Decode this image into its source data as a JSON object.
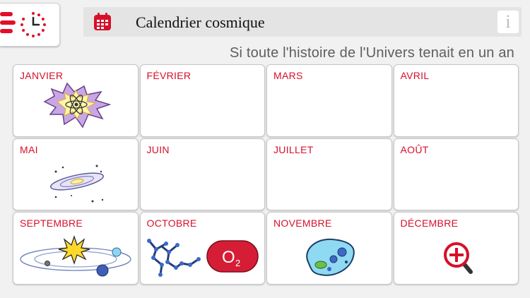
{
  "header": {
    "title": "Calendrier cosmique",
    "info_label": "i"
  },
  "subtitle": "Si toute l'histoire de l'Univers tenait en un an",
  "months": [
    {
      "label": "JANVIER",
      "icon": "big-bang-atom-icon"
    },
    {
      "label": "FÉVRIER",
      "icon": null
    },
    {
      "label": "MARS",
      "icon": null
    },
    {
      "label": "AVRIL",
      "icon": null
    },
    {
      "label": "MAI",
      "icon": "galaxy-icon"
    },
    {
      "label": "JUIN",
      "icon": null
    },
    {
      "label": "JUILLET",
      "icon": null
    },
    {
      "label": "AOÛT",
      "icon": null
    },
    {
      "label": "SEPTEMBRE",
      "icon": "solar-system-icon"
    },
    {
      "label": "OCTOBRE",
      "icon": "molecules-oxygen-icon"
    },
    {
      "label": "NOVEMBRE",
      "icon": "cell-icon"
    },
    {
      "label": "DÉCEMBRE",
      "icon": "zoom-in-icon"
    }
  ],
  "icons": {
    "o2_label": "O",
    "o2_subscript": "2"
  },
  "colors": {
    "accent": "#d6102a",
    "background": "#f1f1f1",
    "header_bg": "#e4e4e4"
  }
}
